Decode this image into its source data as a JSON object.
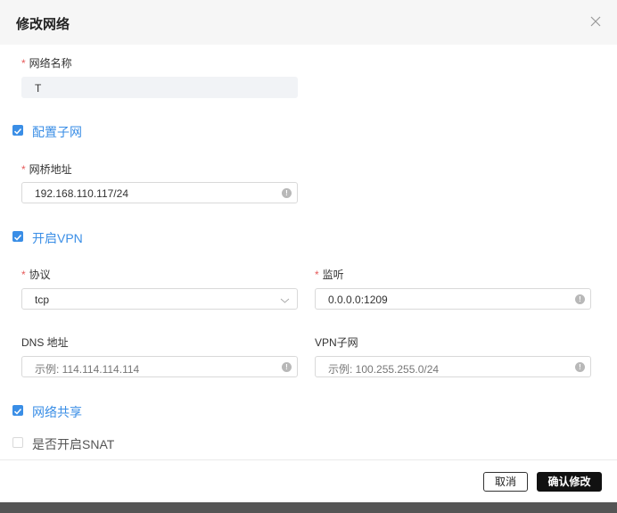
{
  "dialog": {
    "title": "修改网络"
  },
  "network_name": {
    "label": "网络名称",
    "required_mark": "*",
    "value": "T"
  },
  "subnet": {
    "checkbox_label": "配置子网",
    "checked": true,
    "bridge": {
      "label": "网桥地址",
      "required_mark": "*",
      "value": "192.168.110.117/24"
    }
  },
  "vpn": {
    "checkbox_label": "开启VPN",
    "checked": true,
    "protocol": {
      "label": "协议",
      "required_mark": "*",
      "value": "tcp"
    },
    "listen": {
      "label": "监听",
      "required_mark": "*",
      "value": "0.0.0.0:1209"
    },
    "dns": {
      "label": "DNS 地址",
      "placeholder": "示例: 114.114.114.114"
    },
    "vpn_subnet": {
      "label": "VPN子网",
      "placeholder": "示例: 100.255.255.0/24"
    }
  },
  "share": {
    "checkbox_label": "网络共享",
    "checked": true
  },
  "snat": {
    "checkbox_label": "是否开启SNAT",
    "checked": false
  },
  "footer": {
    "cancel_label": "取消",
    "confirm_label": "确认修改"
  },
  "colors": {
    "accent": "#3a8ee6",
    "required": "#e65a5a",
    "primary_button": "#111111"
  }
}
